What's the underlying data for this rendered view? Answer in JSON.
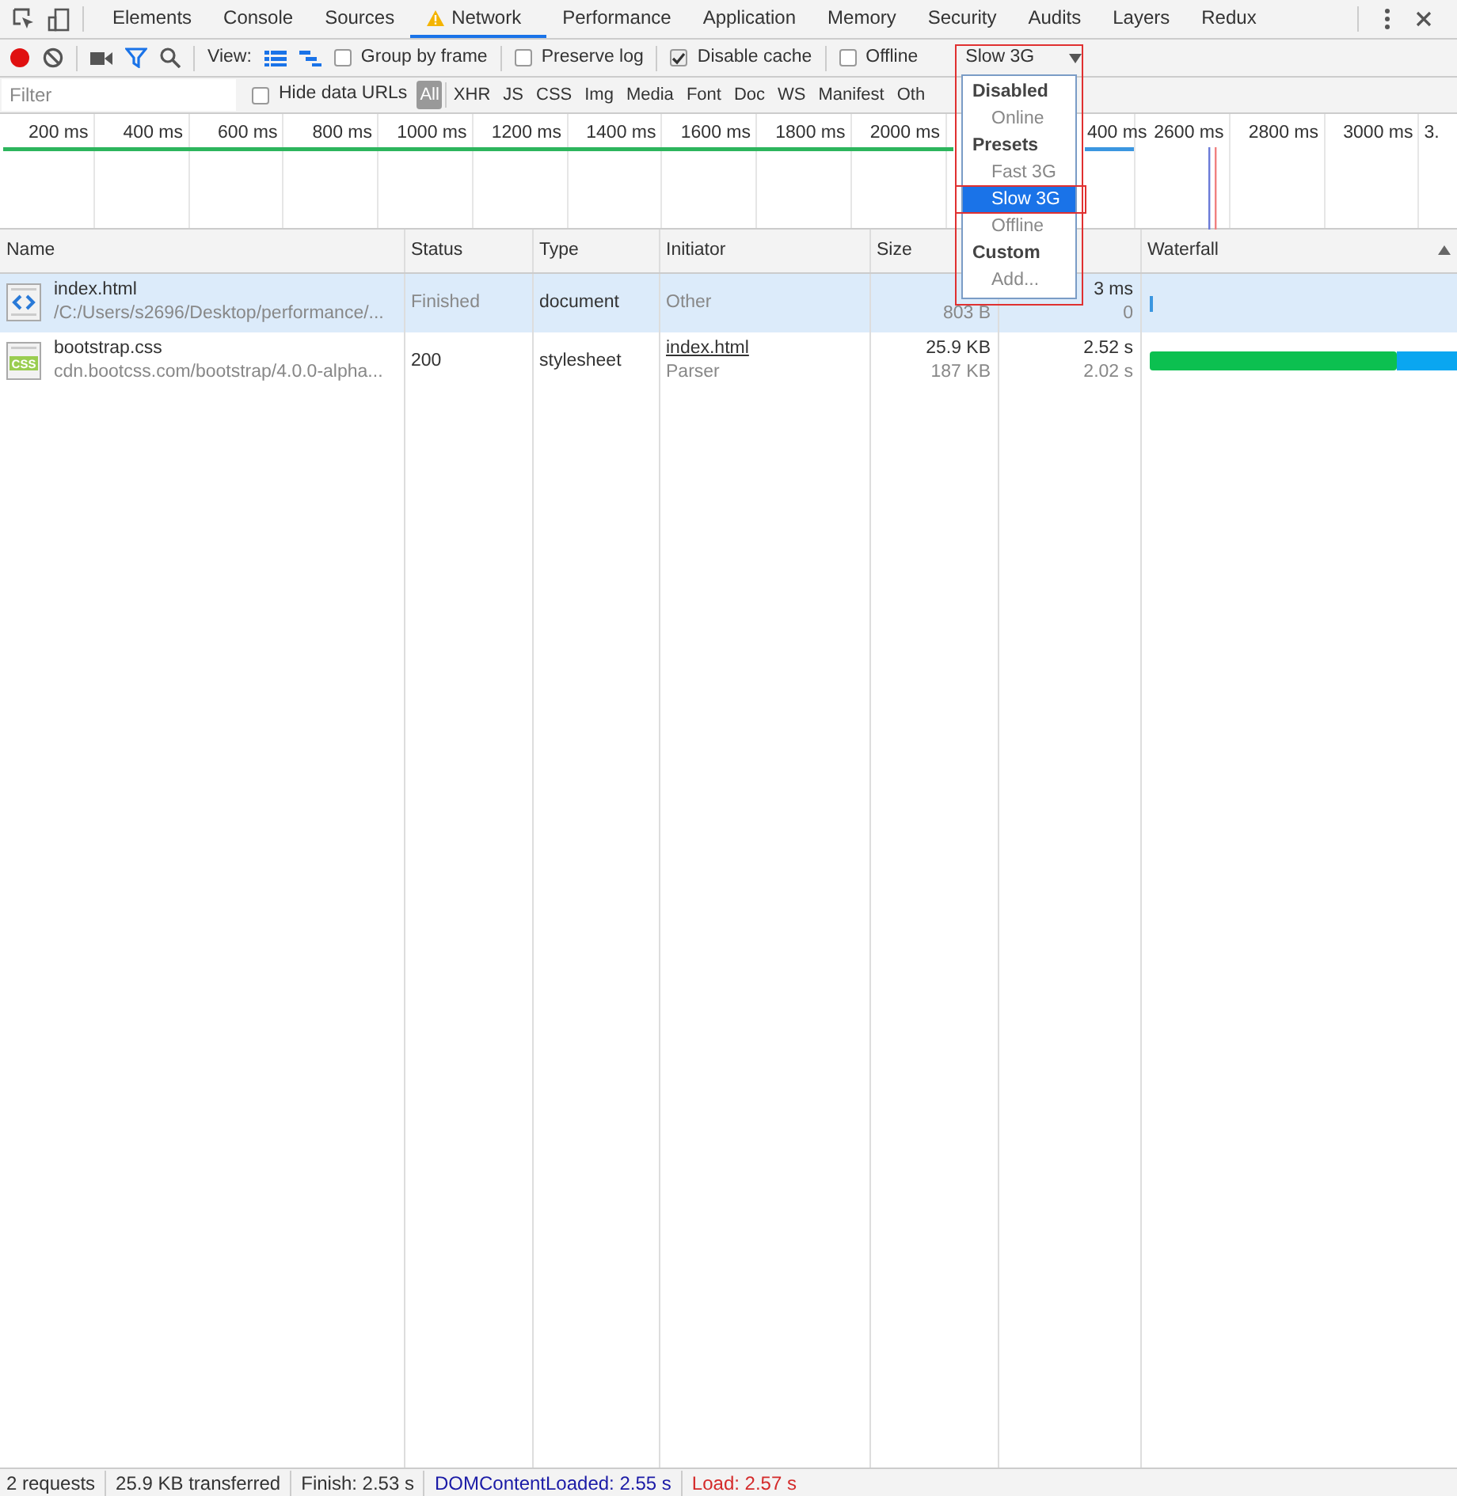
{
  "tabs": [
    {
      "label": "Elements",
      "selected": false,
      "warning": false
    },
    {
      "label": "Console",
      "selected": false,
      "warning": false
    },
    {
      "label": "Sources",
      "selected": false,
      "warning": false
    },
    {
      "label": "Network",
      "selected": true,
      "warning": true
    },
    {
      "label": "Performance",
      "selected": false,
      "warning": false
    },
    {
      "label": "Application",
      "selected": false,
      "warning": false
    },
    {
      "label": "Memory",
      "selected": false,
      "warning": false
    },
    {
      "label": "Security",
      "selected": false,
      "warning": false
    },
    {
      "label": "Audits",
      "selected": false,
      "warning": false
    },
    {
      "label": "Layers",
      "selected": false,
      "warning": false
    },
    {
      "label": "Redux",
      "selected": false,
      "warning": false
    }
  ],
  "toolbar": {
    "recording": true,
    "view_label": "View:",
    "filter_active": true,
    "checkboxes": [
      {
        "label": "Group by frame",
        "checked": false
      },
      {
        "label": "Preserve log",
        "checked": false
      },
      {
        "label": "Disable cache",
        "checked": true
      },
      {
        "label": "Offline",
        "checked": false
      }
    ],
    "throttling": "Slow 3G"
  },
  "filter_bar": {
    "placeholder": "Filter",
    "hide_data_urls": {
      "label": "Hide data URLs",
      "checked": false
    },
    "types": [
      {
        "label": "All",
        "selected": true
      },
      {
        "label": "XHR",
        "selected": false
      },
      {
        "label": "JS",
        "selected": false
      },
      {
        "label": "CSS",
        "selected": false
      },
      {
        "label": "Img",
        "selected": false
      },
      {
        "label": "Media",
        "selected": false
      },
      {
        "label": "Font",
        "selected": false
      },
      {
        "label": "Doc",
        "selected": false
      },
      {
        "label": "WS",
        "selected": false
      },
      {
        "label": "Manifest",
        "selected": false
      },
      {
        "label": "Oth",
        "selected": false
      }
    ]
  },
  "overview": {
    "ticks": [
      "200 ms",
      "400 ms",
      "600 ms",
      "800 ms",
      "1000 ms",
      "1200 ms",
      "1400 ms",
      "1600 ms",
      "1800 ms",
      "2000 ms",
      "400 ms",
      "2600 ms",
      "2800 ms",
      "3000 ms",
      "3."
    ]
  },
  "throttling_menu": [
    {
      "label": "Disabled",
      "kind": "group",
      "selected": false
    },
    {
      "label": "Online",
      "kind": "option",
      "selected": false
    },
    {
      "label": "Presets",
      "kind": "group",
      "selected": false
    },
    {
      "label": "Fast 3G",
      "kind": "option",
      "selected": false
    },
    {
      "label": "Slow 3G",
      "kind": "option",
      "selected": true
    },
    {
      "label": "Offline",
      "kind": "option",
      "selected": false
    },
    {
      "label": "Custom",
      "kind": "group",
      "selected": false
    },
    {
      "label": "Add...",
      "kind": "option",
      "selected": false
    }
  ],
  "table": {
    "columns": [
      "Name",
      "Status",
      "Type",
      "Initiator",
      "Size",
      "Waterfall"
    ],
    "rows": [
      {
        "kind": "html",
        "name": "index.html",
        "path": "/C:/Users/s2696/Desktop/performance/...",
        "status": "Finished",
        "status_dimmed": true,
        "type": "document",
        "initiator": "Other",
        "initiator_link": false,
        "size_resource": "803 B",
        "time": "3 ms",
        "latency": "0",
        "selected": true,
        "waterfall": {
          "kind": "short"
        }
      },
      {
        "kind": "css",
        "icon_text": "CSS",
        "name": "bootstrap.css",
        "path": "cdn.bootcss.com/bootstrap/4.0.0-alpha...",
        "status": "200",
        "status_dimmed": false,
        "type": "stylesheet",
        "initiator": "index.html",
        "initiator_link": true,
        "initiator_detail": "Parser",
        "size": "25.9 KB",
        "size_resource": "187 KB",
        "time": "2.52 s",
        "latency": "2.02 s",
        "selected": false,
        "waterfall": {
          "kind": "long"
        }
      }
    ]
  },
  "status_bar": [
    {
      "text": "2 requests",
      "kind": "plain"
    },
    {
      "text": "25.9 KB transferred",
      "kind": "plain"
    },
    {
      "text": "Finish: 2.53 s",
      "kind": "plain"
    },
    {
      "text": "DOMContentLoaded: 2.55 s",
      "kind": "dom"
    },
    {
      "text": "Load: 2.57 s",
      "kind": "load"
    }
  ]
}
